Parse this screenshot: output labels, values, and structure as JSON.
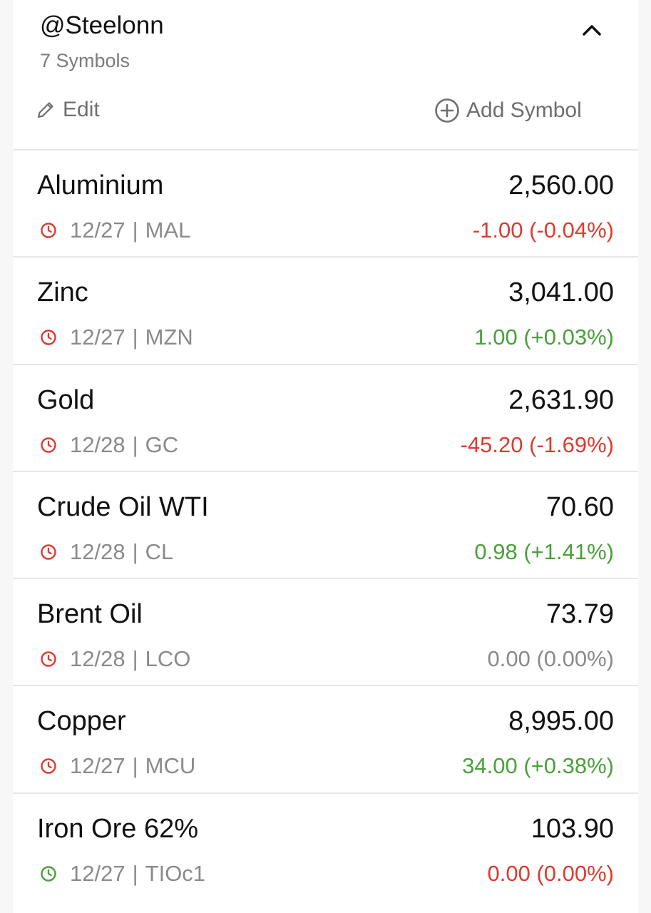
{
  "header": {
    "title": "@Steelonn",
    "symbol_count": "7 Symbols",
    "edit_label": "Edit",
    "add_label": "Add Symbol"
  },
  "colors": {
    "down": "#e03a2f",
    "up": "#4aa03a",
    "flat": "#8a8a8a",
    "market_closed_icon": "#e03a2f",
    "market_open_icon": "#4aa03a"
  },
  "symbols": [
    {
      "name": "Aluminium",
      "price": "2,560.00",
      "date": "12/27",
      "ticker": "MAL",
      "change": "-1.00 (-0.04%)",
      "trend": "down",
      "status_icon": "clock-icon",
      "status_color": "#e03a2f"
    },
    {
      "name": "Zinc",
      "price": "3,041.00",
      "date": "12/27",
      "ticker": "MZN",
      "change": "1.00 (+0.03%)",
      "trend": "up",
      "status_icon": "clock-icon",
      "status_color": "#e03a2f"
    },
    {
      "name": "Gold",
      "price": "2,631.90",
      "date": "12/28",
      "ticker": "GC",
      "change": "-45.20 (-1.69%)",
      "trend": "down",
      "status_icon": "clock-icon",
      "status_color": "#e03a2f"
    },
    {
      "name": "Crude Oil WTI",
      "price": "70.60",
      "date": "12/28",
      "ticker": "CL",
      "change": "0.98 (+1.41%)",
      "trend": "up",
      "status_icon": "clock-icon",
      "status_color": "#e03a2f"
    },
    {
      "name": "Brent Oil",
      "price": "73.79",
      "date": "12/28",
      "ticker": "LCO",
      "change": "0.00 (0.00%)",
      "trend": "flat",
      "status_icon": "clock-icon",
      "status_color": "#e03a2f"
    },
    {
      "name": "Copper",
      "price": "8,995.00",
      "date": "12/27",
      "ticker": "MCU",
      "change": "34.00 (+0.38%)",
      "trend": "up",
      "status_icon": "clock-icon",
      "status_color": "#e03a2f"
    },
    {
      "name": "Iron Ore 62%",
      "price": "103.90",
      "date": "12/27",
      "ticker": "TIOc1",
      "change": "0.00 (0.00%)",
      "trend": "down",
      "status_icon": "clock-icon",
      "status_color": "#4aa03a"
    }
  ]
}
